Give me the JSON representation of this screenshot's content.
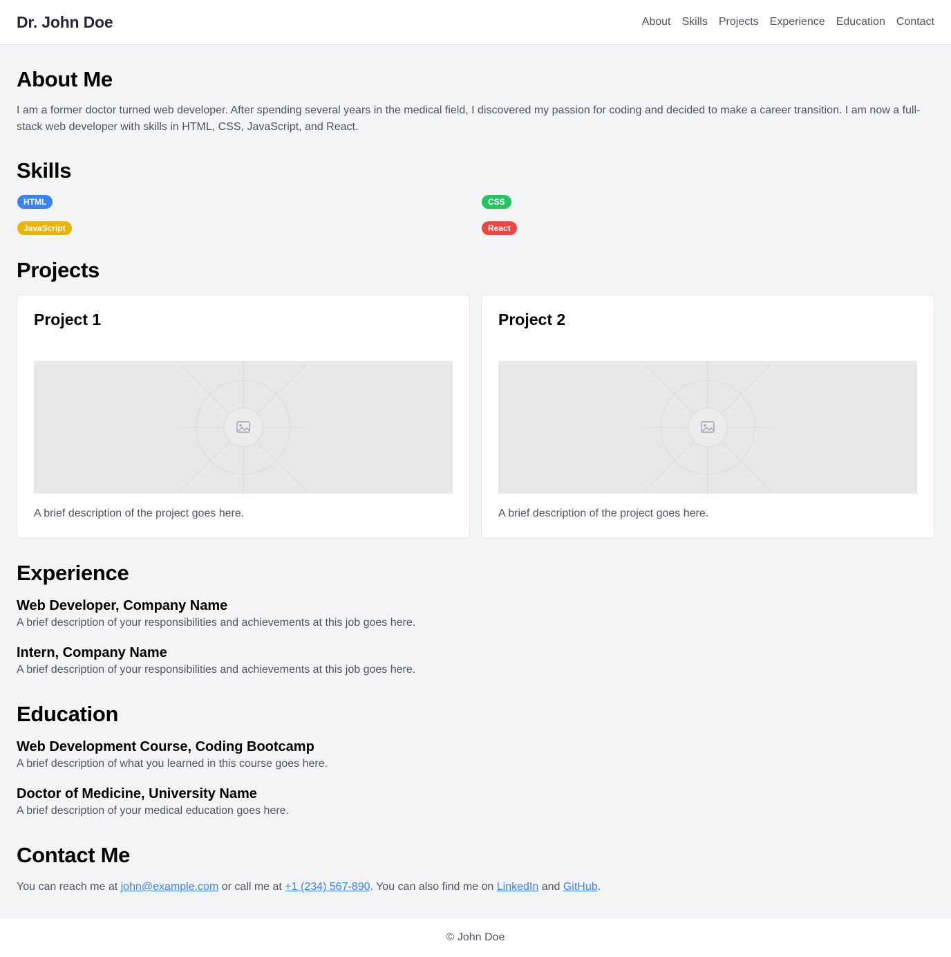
{
  "header": {
    "brand": "Dr. John Doe",
    "nav": [
      "About",
      "Skills",
      "Projects",
      "Experience",
      "Education",
      "Contact"
    ]
  },
  "about": {
    "title": "About Me",
    "text": "I am a former doctor turned web developer. After spending several years in the medical field, I discovered my passion for coding and decided to make a career transition. I am now a full-stack web developer with skills in HTML, CSS, JavaScript, and React."
  },
  "skills": {
    "title": "Skills",
    "items": [
      {
        "label": "HTML",
        "color": "#3b82f6"
      },
      {
        "label": "CSS",
        "color": "#22c55e"
      },
      {
        "label": "JavaScript",
        "color": "#eab308"
      },
      {
        "label": "React",
        "color": "#ef4444"
      }
    ]
  },
  "projects": {
    "title": "Projects",
    "items": [
      {
        "title": "Project 1",
        "description": "A brief description of the project goes here."
      },
      {
        "title": "Project 2",
        "description": "A brief description of the project goes here."
      }
    ]
  },
  "experience": {
    "title": "Experience",
    "items": [
      {
        "title": "Web Developer, Company Name",
        "description": "A brief description of your responsibilities and achievements at this job goes here."
      },
      {
        "title": "Intern, Company Name",
        "description": "A brief description of your responsibilities and achievements at this job goes here."
      }
    ]
  },
  "education": {
    "title": "Education",
    "items": [
      {
        "title": "Web Development Course, Coding Bootcamp",
        "description": "A brief description of what you learned in this course goes here."
      },
      {
        "title": "Doctor of Medicine, University Name",
        "description": "A brief description of your medical education goes here."
      }
    ]
  },
  "contact": {
    "title": "Contact Me",
    "prefix": "You can reach me at ",
    "email": "john@example.com",
    "mid1": " or call me at ",
    "phone": "+1 (234) 567-890",
    "mid2": ". You can also find me on ",
    "linkedin": "LinkedIn",
    "mid3": " and ",
    "github": "GitHub",
    "suffix": "."
  },
  "footer": {
    "text": "© John Doe"
  }
}
